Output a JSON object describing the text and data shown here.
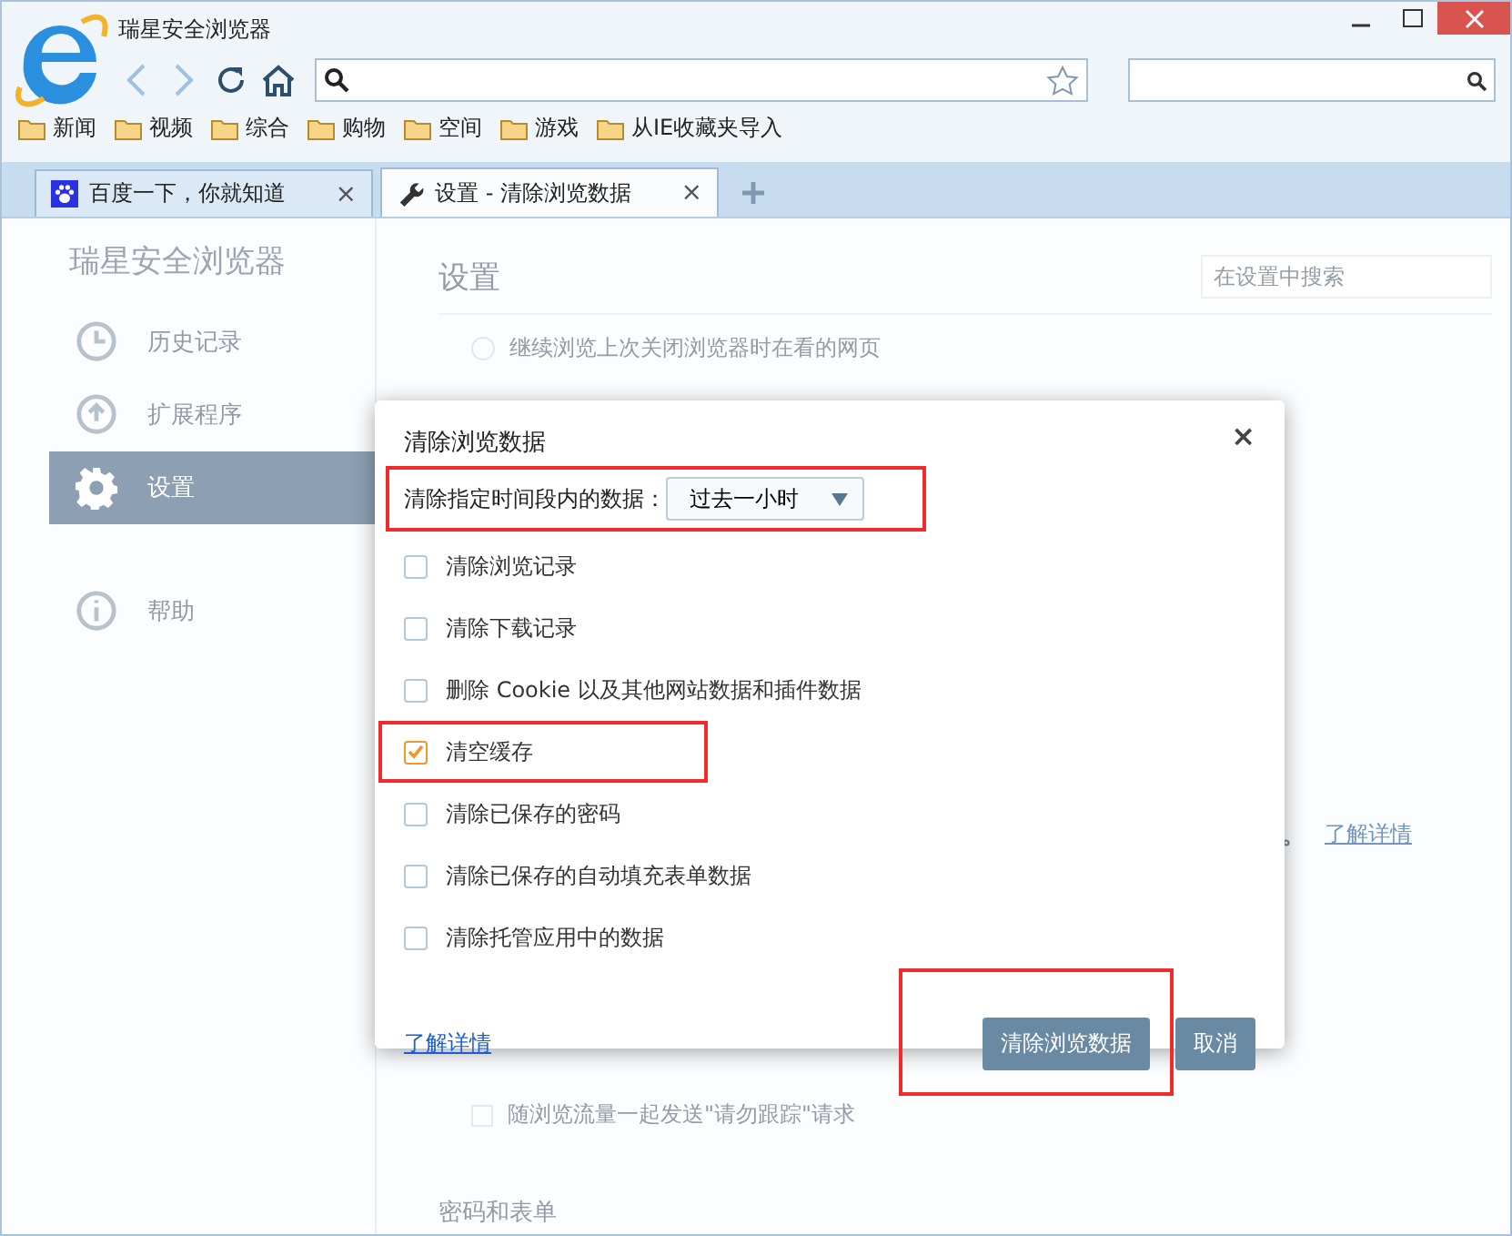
{
  "window": {
    "title": "瑞星安全浏览器"
  },
  "bookmarks": [
    {
      "label": "新闻"
    },
    {
      "label": "视频"
    },
    {
      "label": "综合"
    },
    {
      "label": "购物"
    },
    {
      "label": "空间"
    },
    {
      "label": "游戏"
    },
    {
      "label": "从IE收藏夹导入"
    }
  ],
  "tabs": [
    {
      "label": "百度一下，你就知道",
      "kind": "paw",
      "selected": false,
      "close": "×"
    },
    {
      "label": "设置 - 清除浏览数据",
      "kind": "wrench",
      "selected": true,
      "close": "×"
    }
  ],
  "sidebar": {
    "brand": "瑞星安全浏览器",
    "items": [
      {
        "label": "历史记录",
        "kind": "history",
        "selected": false
      },
      {
        "label": "扩展程序",
        "kind": "extensions",
        "selected": false
      },
      {
        "label": "设置",
        "kind": "settings",
        "selected": true
      },
      {
        "label": "帮助",
        "kind": "help",
        "selected": false
      }
    ]
  },
  "settings": {
    "title": "设置",
    "search": {
      "placeholder": "在设置中搜索"
    },
    "startup_option": {
      "label": "继续浏览上次关闭浏览器时在看的网页",
      "selected": false
    },
    "note_end": "。",
    "link": "了解详情",
    "dnt_option": {
      "label": "随浏览流量一起发送\"请勿跟踪\"请求",
      "checked": false
    },
    "section": "密码和表单"
  },
  "dialog": {
    "title": "清除浏览数据",
    "close": "×",
    "time_range": {
      "label": "清除指定时间段内的数据：",
      "value": "过去一小时",
      "highlighted": true
    },
    "options": [
      {
        "label": "清除浏览记录",
        "checked": false,
        "highlighted": false
      },
      {
        "label": "清除下载记录",
        "checked": false,
        "highlighted": false
      },
      {
        "label": "删除 Cookie 以及其他网站数据和插件数据",
        "checked": false,
        "highlighted": false
      },
      {
        "label": "清空缓存",
        "checked": true,
        "highlighted": true
      },
      {
        "label": "清除已保存的密码",
        "checked": false,
        "highlighted": false
      },
      {
        "label": "清除已保存的自动填充表单数据",
        "checked": false,
        "highlighted": false
      },
      {
        "label": "清除托管应用中的数据",
        "checked": false,
        "highlighted": false
      }
    ],
    "link": "了解详情",
    "buttons": [
      {
        "label": "清除浏览数据",
        "highlighted": true
      },
      {
        "label": "取消",
        "highlighted": false
      }
    ]
  }
}
